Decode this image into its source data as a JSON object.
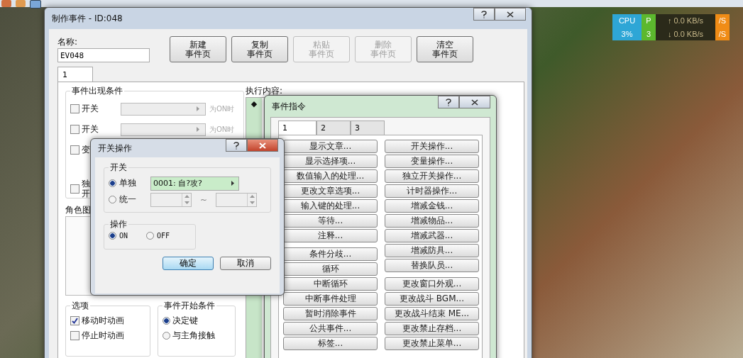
{
  "main_window": {
    "title": "制作事件 - ID:048",
    "name_label": "名称:",
    "name_value": "EV048",
    "page_buttons": [
      {
        "line1": "新建",
        "line2": "事件页",
        "disabled": false
      },
      {
        "line1": "复制",
        "line2": "事件页",
        "disabled": false
      },
      {
        "line1": "粘贴",
        "line2": "事件页",
        "disabled": true
      },
      {
        "line1": "删除",
        "line2": "事件页",
        "disabled": true
      },
      {
        "line1": "清空",
        "line2": "事件页",
        "disabled": false
      }
    ],
    "tabs": [
      {
        "label": "1",
        "selected": true
      }
    ],
    "conditions": {
      "title": "事件出现条件",
      "rows": [
        {
          "label": "开关",
          "checked": false,
          "suffix": "为ON时"
        },
        {
          "label": "开关",
          "checked": false,
          "suffix": "为ON时"
        },
        {
          "label": "变",
          "checked": false
        },
        {
          "label": "独开",
          "checked": false
        }
      ]
    },
    "graphic_label": "角色图",
    "options": {
      "title": "选项",
      "items": [
        {
          "label": "移动时动画",
          "checked": true
        },
        {
          "label": "停止时动画",
          "checked": false
        }
      ]
    },
    "trigger": {
      "title": "事件开始条件",
      "items": [
        {
          "label": "决定键",
          "selected": true
        },
        {
          "label": "与主角接触",
          "selected": false
        }
      ]
    },
    "contents_label": "执行内容:",
    "contents_marker": "◆"
  },
  "event_commands": {
    "title": "事件指令",
    "tabs": [
      {
        "label": "1",
        "selected": true
      },
      {
        "label": "2",
        "selected": false
      },
      {
        "label": "3",
        "selected": false
      }
    ],
    "columns": [
      [
        [
          "显示文章...",
          "显示选择项...",
          "数值输入的处理...",
          "更改文章选项...",
          "输入键的处理...",
          "等待...",
          "注释..."
        ],
        [
          "条件分歧...",
          "循环",
          "中断循环",
          "中断事件处理",
          "暂时消除事件",
          "公共事件...",
          "标签..."
        ]
      ],
      [
        [
          "开关操作...",
          "变量操作...",
          "独立开关操作...",
          "计时器操作...",
          "增减金钱...",
          "增减物品...",
          "增减武器...",
          "增减防具...",
          "替换队员..."
        ],
        [
          "更改窗口外观...",
          "更改战斗 BGM...",
          "更改战斗结束 ME...",
          "更改禁止存档...",
          "更改禁止菜单..."
        ]
      ]
    ]
  },
  "switch_dialog": {
    "title": "开关操作",
    "switch_group": "开关",
    "single": {
      "label": "单独",
      "selected": true,
      "value": "0001: 自?攻?"
    },
    "range": {
      "label": "统一",
      "selected": false,
      "tilde": "~"
    },
    "operation_group": "操作",
    "operations": [
      {
        "label": "ON",
        "selected": true
      },
      {
        "label": "OFF",
        "selected": false
      }
    ],
    "buttons": [
      {
        "label": "确定",
        "kind": "default"
      },
      {
        "label": "取消",
        "kind": "normal"
      }
    ]
  },
  "monitor": {
    "cpu_label": "CPU",
    "cpu_value": "3%",
    "second": [
      "P",
      "3"
    ],
    "upload": "↑ 0.0 KB/s",
    "download": "↓ 0.0 KB/s",
    "fourth": [
      "/S",
      "/S"
    ]
  }
}
